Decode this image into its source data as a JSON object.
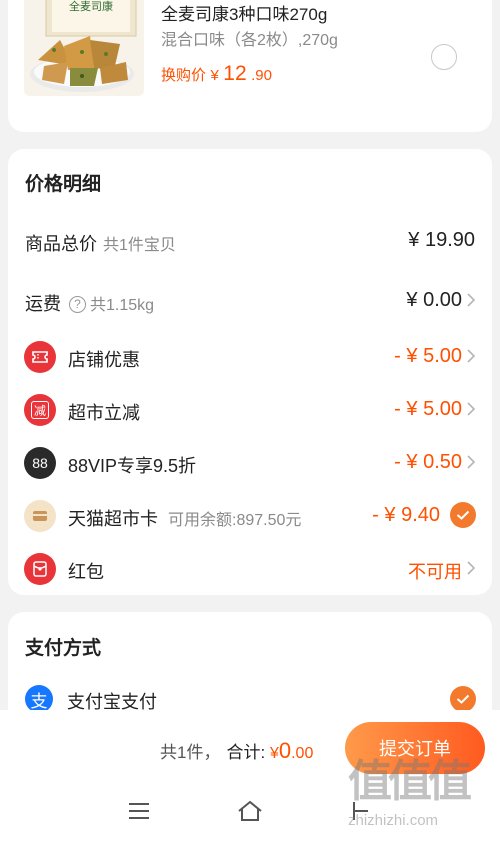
{
  "product": {
    "name": "全麦司康3种口味270g",
    "spec": "混合口味（各2枚）,270g",
    "price_label": "换购价",
    "currency": "¥",
    "price_int": "12",
    "price_dec": ".90",
    "box_text": "全麦司康"
  },
  "price_detail": {
    "title": "价格明细",
    "goods_total": {
      "label": "商品总价",
      "sub": "共1件宝贝",
      "value": "¥ 19.90"
    },
    "shipping": {
      "label": "运费",
      "help": "?",
      "sub": "共1.15kg",
      "value": "¥ 0.00"
    },
    "discounts": [
      {
        "label": "店铺优惠",
        "value": "- ¥ 5.00",
        "icon": "coupon-icon",
        "icon_color": "#e9343a"
      },
      {
        "label": "超市立减",
        "value": "- ¥ 5.00",
        "icon": "reduce-icon",
        "icon_color": "#e9343a",
        "icon_text": "减"
      },
      {
        "label": "88VIP专享9.5折",
        "value": "- ¥ 0.50",
        "icon": "vip88-icon",
        "icon_color": "#2a2a2a",
        "icon_text": "88"
      }
    ],
    "card": {
      "label": "天猫超市卡",
      "sub": "可用余额:897.50元",
      "value": "- ¥ 9.40",
      "icon": "supermarket-card-icon"
    },
    "red_packet": {
      "label": "红包",
      "value": "不可用",
      "icon": "red-packet-icon"
    }
  },
  "payment": {
    "title": "支付方式",
    "method": "支付宝支付",
    "icon_text": "支"
  },
  "bottom": {
    "count": "共1件，",
    "total_label": "合计:",
    "currency": "¥",
    "total_int": "0",
    "total_dec": ".00",
    "submit": "提交订单"
  },
  "watermark": {
    "big": "值值值",
    "small": "zhizhizhi.com"
  },
  "colors": {
    "accent": "#ff5000",
    "check": "#f37a2c",
    "alipay": "#1677ff"
  }
}
